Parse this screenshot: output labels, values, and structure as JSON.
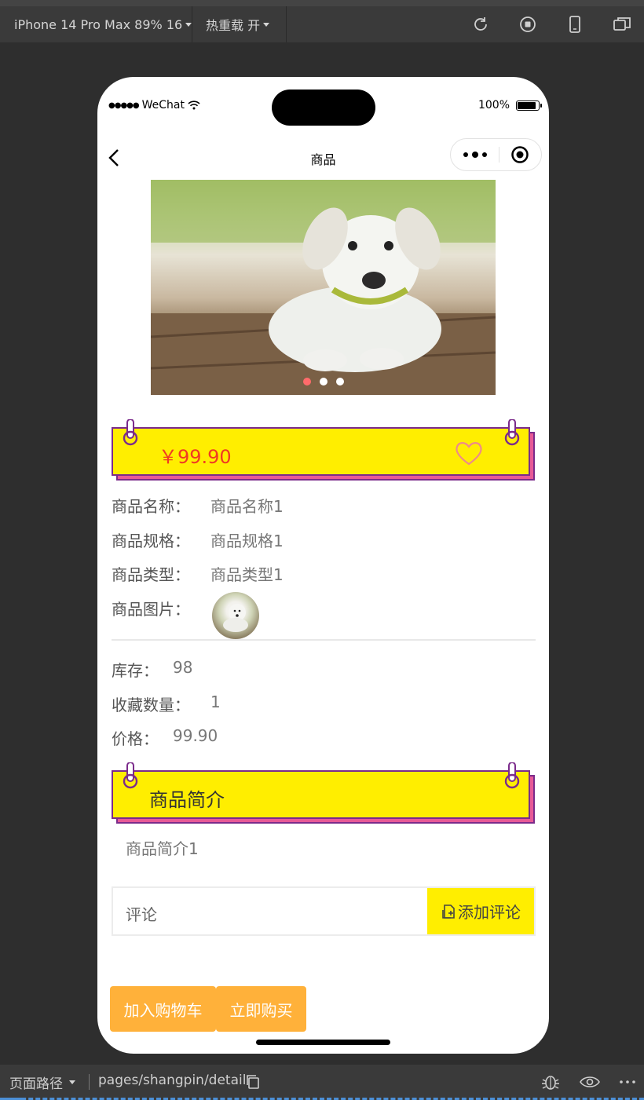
{
  "toolbar": {
    "device": "iPhone 14 Pro Max 89% 16",
    "hot_reload": "热重载 开",
    "icons": [
      "refresh-icon",
      "stop-record-icon",
      "phone-icon",
      "window-icon"
    ]
  },
  "status_bar": {
    "carrier": "WeChat",
    "battery": "100%"
  },
  "navbar": {
    "title": "商品"
  },
  "banner": {
    "slides": 3,
    "active_index": 0,
    "alt": "white puppy"
  },
  "price_tag": {
    "price": "￥99.90"
  },
  "details": {
    "name_label": "商品名称：",
    "name_value": "商品名称1",
    "spec_label": "商品规格：",
    "spec_value": "商品规格1",
    "type_label": "商品类型：",
    "type_value": "商品类型1",
    "image_label": "商品图片："
  },
  "stats": {
    "stock_label": "库存：",
    "stock_value": "98",
    "fav_label": "收藏数量：",
    "fav_value": "1",
    "price_label": "价格：",
    "price_value": "99.90"
  },
  "intro": {
    "title": "商品简介",
    "content": "商品简介1"
  },
  "comment": {
    "label": "评论",
    "add_button": "添加评论"
  },
  "footer": {
    "cart_button": "加入购物车",
    "buy_button": "立即购买"
  },
  "bottombar": {
    "path_label": "页面路径",
    "path": "pages/shangpin/detail"
  },
  "colors": {
    "tag_yellow": "#ffee00",
    "tag_border": "#7b2b8b",
    "tag_shadow": "#e75a96",
    "price_red": "#f03a23",
    "button_orange": "#ffb13a"
  }
}
